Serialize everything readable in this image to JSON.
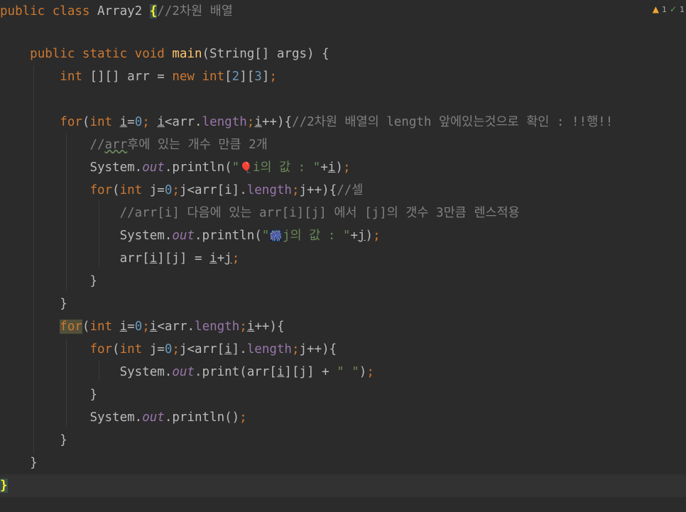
{
  "inspections": {
    "warning_count": "1",
    "typo_count": "1",
    "warning_icon": "warning-icon",
    "typo_icon": "typo-check-icon"
  },
  "code": {
    "l1": {
      "kw": "public class",
      "name": " Array2 ",
      "brace": "{",
      "comment": "//2차원 배열"
    },
    "l3": {
      "kw": "public static void",
      "fn": "main",
      "rest": "(String[] args) {"
    },
    "l4": {
      "kw": "int",
      "decl": " [][] arr = ",
      "kw2": "new int",
      "open": "[",
      "n1": "2",
      "mid": "][",
      "n2": "3",
      "close": "]",
      "semi": ";"
    },
    "l6": {
      "kw": "for",
      "p1": "(",
      "kw2": "int",
      "sp": " ",
      "i1": "i",
      "eq": "=",
      "zero": "0",
      "semi1": "; ",
      "i2": "i",
      "lt": "<arr.",
      "len": "length",
      "semi2": ";",
      "i3": "i",
      "inc": "++){",
      "comment": "//2차원 배열의 length 앞에있는것으로 확인 : !!행!!"
    },
    "l7": {
      "c1": "//",
      "arr": "arr",
      "c2": "후에 있는 개수 만큼 2개"
    },
    "l8": {
      "sys": "System.",
      "out": "out",
      "call": ".println(",
      "q": "\"",
      "emoji": "🎈",
      "str": "i의 값 : ",
      "q2": "\"",
      "plus": "+",
      "i": "i",
      "close": ")",
      "semi": ";"
    },
    "l9": {
      "kw": "for",
      "p1": "(",
      "kw2": "int",
      "decl": " j=",
      "zero": "0",
      "semi1": ";",
      "cond": "j<arr[i].",
      "len": "length",
      "semi2": ";",
      "inc": "j++){",
      "comment": "//셀"
    },
    "l10": {
      "comment": "//arr[i] 다음에 있는 arr[i][j] 에서 [j]의 갯수 3만큼 렌스적용"
    },
    "l11": {
      "sys": "System.",
      "out": "out",
      "call": ".println(",
      "q": "\"",
      "emoji": "🎆",
      "str": "j의 값 : ",
      "q2": "\"",
      "plus": "+",
      "j": "j",
      "close": ")",
      "semi": ";"
    },
    "l12": {
      "a": "arr[",
      "i": "i",
      "b": "][j] = ",
      "i2": "i",
      "plus": "+",
      "j": "j",
      "semi": ";"
    },
    "l13": {
      "brace": "}"
    },
    "l14": {
      "brace": "}"
    },
    "l15": {
      "kw": "for",
      "p1": "(",
      "kw2": "int",
      "sp": " ",
      "i1": "i",
      "eq": "=",
      "zero": "0",
      "semi1": ";",
      "i2": "i",
      "lt": "<arr.",
      "len": "length",
      "semi2": ";",
      "i3": "i",
      "inc": "++){"
    },
    "l16": {
      "kw": "for",
      "p1": "(",
      "kw2": "int",
      "decl": " j=",
      "zero": "0",
      "semi1": ";",
      "cond1": "j<arr[",
      "i": "i",
      "cond2": "].",
      "len": "length",
      "semi2": ";",
      "inc": "j++){"
    },
    "l17": {
      "sys": "System.",
      "out": "out",
      "call": ".print(arr[",
      "i": "i",
      "rest": "][j] + ",
      "str": "\" \"",
      "close": ")",
      "semi": ";"
    },
    "l18": {
      "brace": "}"
    },
    "l19": {
      "sys": "System.",
      "out": "out",
      "call": ".println()",
      "semi": ";"
    },
    "l20": {
      "brace": "}"
    },
    "l21": {
      "brace": "}"
    },
    "l22": {
      "brace": "}"
    }
  }
}
